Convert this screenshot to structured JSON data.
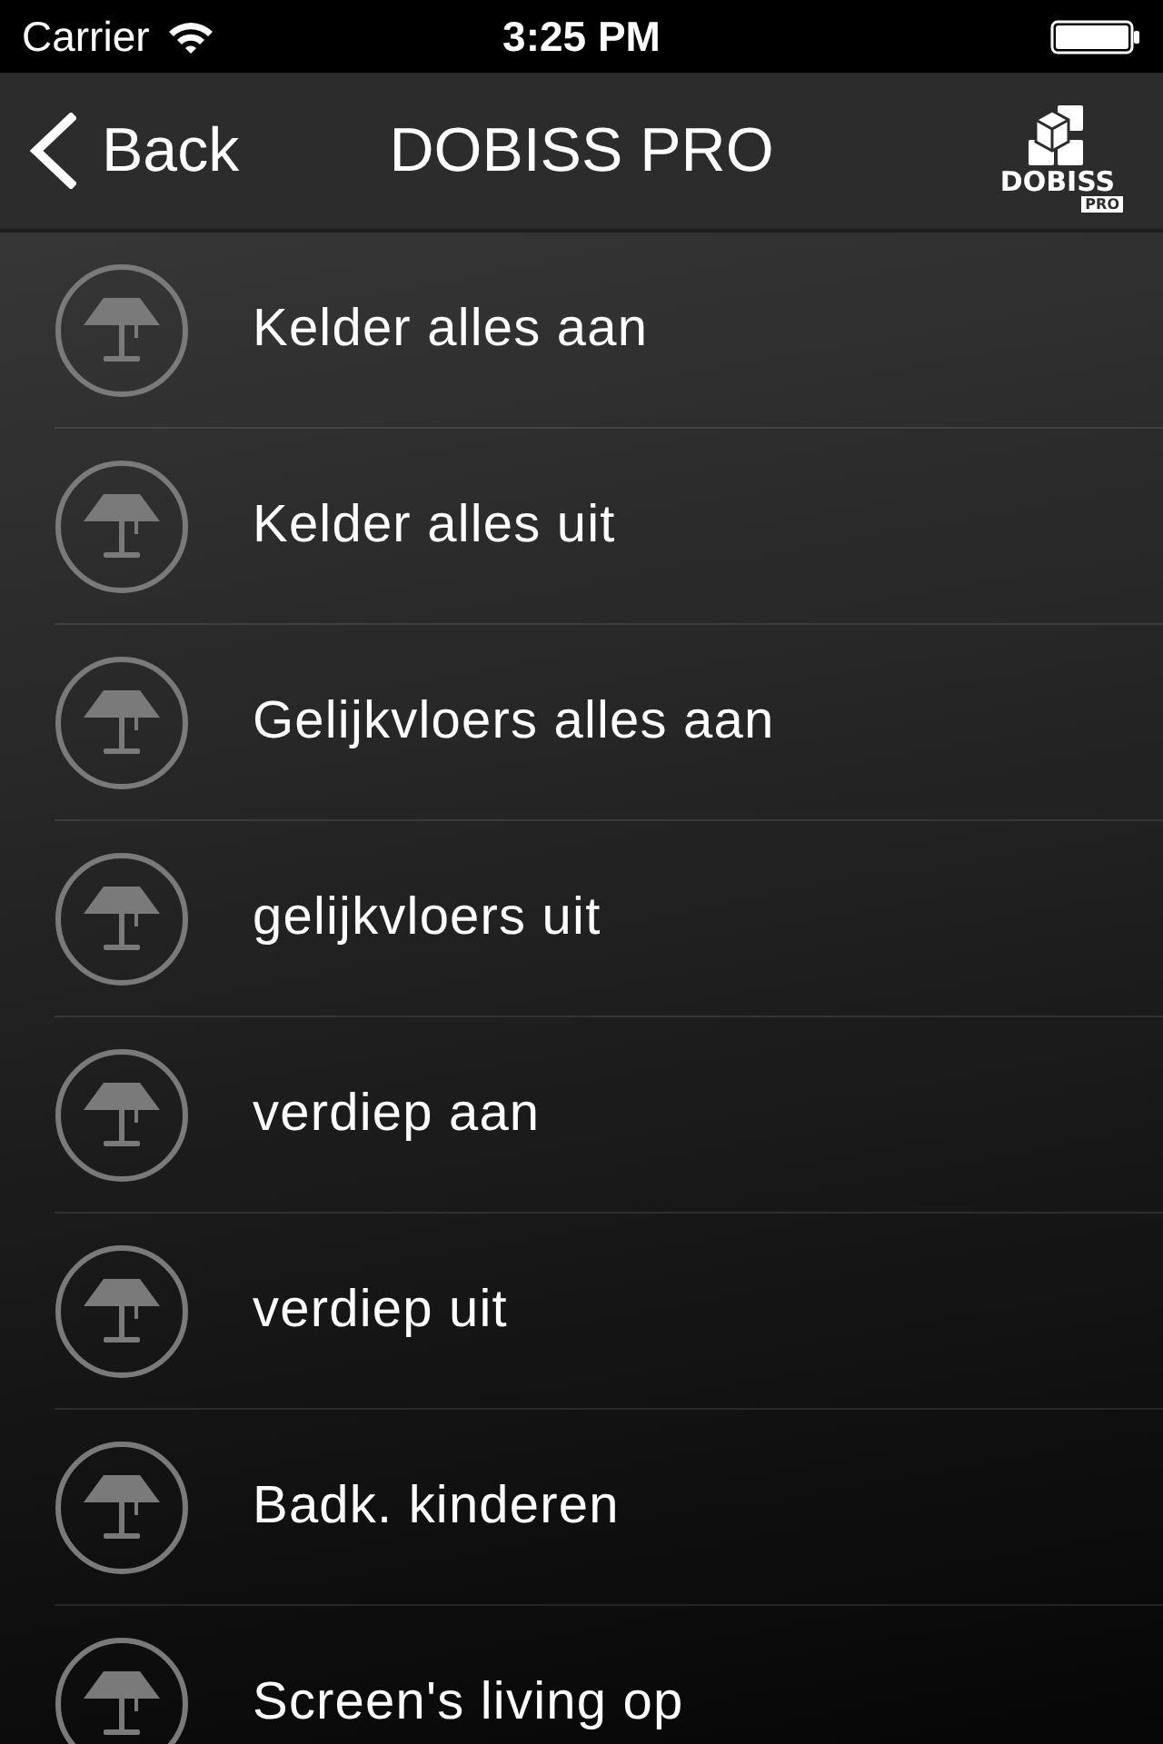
{
  "status_bar": {
    "carrier": "Carrier",
    "time": "3:25 PM"
  },
  "nav_bar": {
    "back": "Back",
    "title": "DOBISS PRO",
    "logo": {
      "name": "DOBISS",
      "badge": "PRO"
    }
  },
  "items": [
    {
      "label": "Kelder alles aan"
    },
    {
      "label": "Kelder alles uit"
    },
    {
      "label": "Gelijkvloers alles aan"
    },
    {
      "label": "gelijkvloers uit"
    },
    {
      "label": "verdiep aan"
    },
    {
      "label": "verdiep uit"
    },
    {
      "label": "Badk. kinderen"
    },
    {
      "label": "Screen's living op"
    }
  ]
}
